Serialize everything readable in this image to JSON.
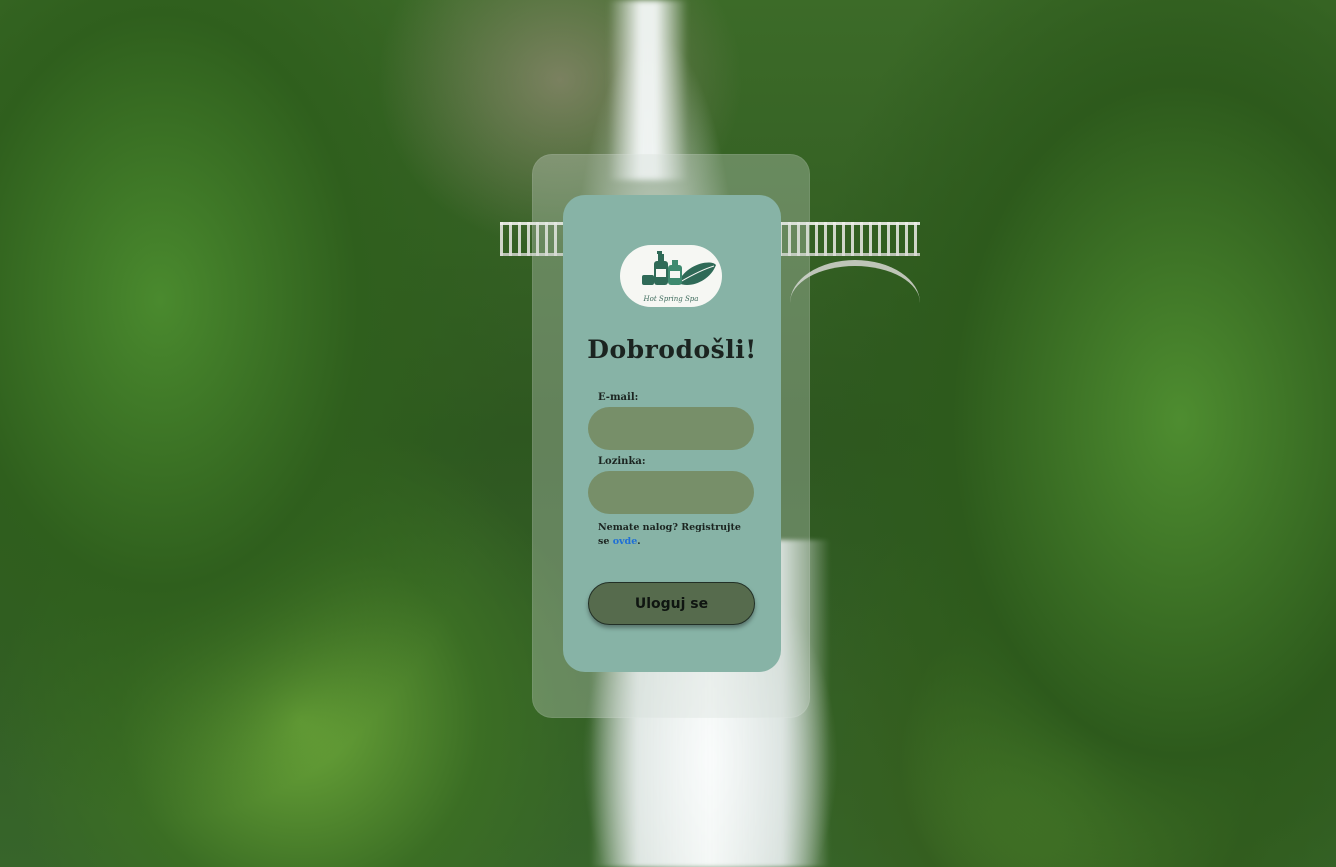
{
  "background": {
    "description_icon": "waterfall-landscape-image"
  },
  "brand": {
    "logo_text": "Hot Spring Spa",
    "logo_icon": "spa-bottles-leaf-icon"
  },
  "form": {
    "title": "Dobrodošli!",
    "email_label": "E-mail:",
    "email_value": "",
    "password_label": "Lozinka:",
    "password_value": "",
    "register_prefix": "Nemate nalog? Registrujte se ",
    "register_link": "ovde",
    "register_suffix": ".",
    "login_button": "Uloguj se"
  },
  "colors": {
    "card": "#87b3a6",
    "input": "#778f69",
    "button": "#566b4d",
    "link": "#1f6fd6"
  }
}
